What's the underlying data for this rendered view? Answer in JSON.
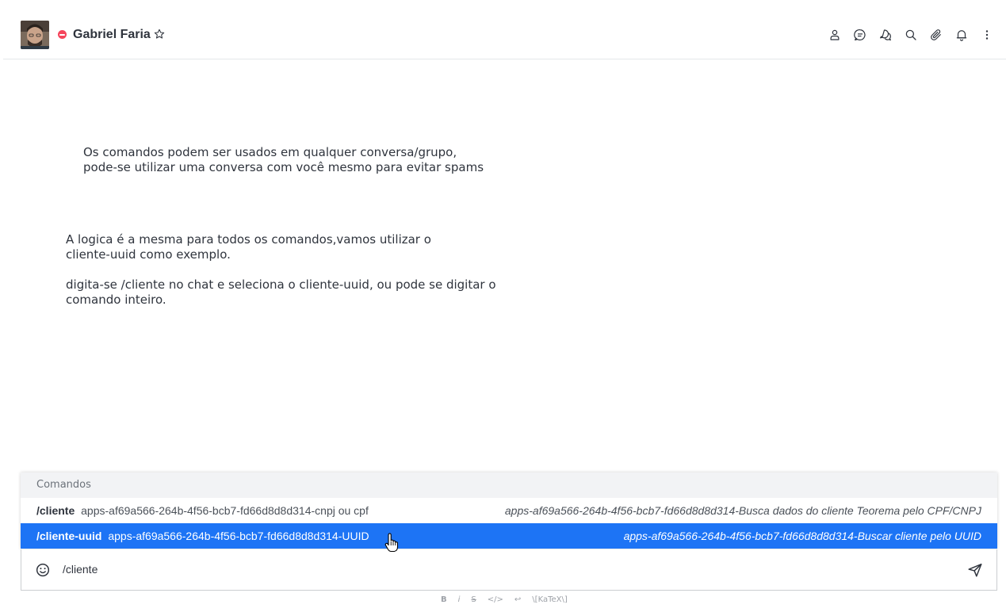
{
  "header": {
    "room_name": "Gabriel Faria",
    "status": "busy",
    "status_color": "#f5455c",
    "actions": [
      {
        "name": "user-info-icon"
      },
      {
        "name": "discussion-icon"
      },
      {
        "name": "threads-icon"
      },
      {
        "name": "search-icon"
      },
      {
        "name": "attachment-icon"
      },
      {
        "name": "notifications-icon"
      },
      {
        "name": "kebab-menu-icon"
      }
    ]
  },
  "messages": {
    "msg1": "Os comandos podem ser usados em qualquer conversa/grupo,\npode-se utilizar uma conversa com você mesmo para evitar spams",
    "msg2": "A logica é a mesma para todos os comandos,vamos utilizar o\ncliente-uuid como exemplo.",
    "msg3": "digita-se /cliente no chat e seleciona o cliente-uuid, ou pode se digitar o\ncomando inteiro."
  },
  "popup": {
    "title": "Comandos",
    "items": [
      {
        "command": "/cliente",
        "params": "apps-af69a566-264b-4f56-bcb7-fd66d8d8d314-cnpj ou cpf",
        "description": "apps-af69a566-264b-4f56-bcb7-fd66d8d8d314-Busca dados do cliente Teorema pelo CPF/CNPJ",
        "selected": false
      },
      {
        "command": "/cliente-uuid",
        "params": "apps-af69a566-264b-4f56-bcb7-fd66d8d8d314-UUID",
        "description": "apps-af69a566-264b-4f56-bcb7-fd66d8d8d314-Buscar cliente pelo UUID",
        "selected": true
      }
    ]
  },
  "composer": {
    "value": "/cliente",
    "formatting": {
      "bold": "B",
      "italic": "i",
      "strike": "S",
      "code": "</>",
      "multiline": "↩",
      "katex": "\\[KaTeX\\]"
    }
  },
  "colors": {
    "accent": "#1d74f5",
    "text": "#2f343d"
  }
}
